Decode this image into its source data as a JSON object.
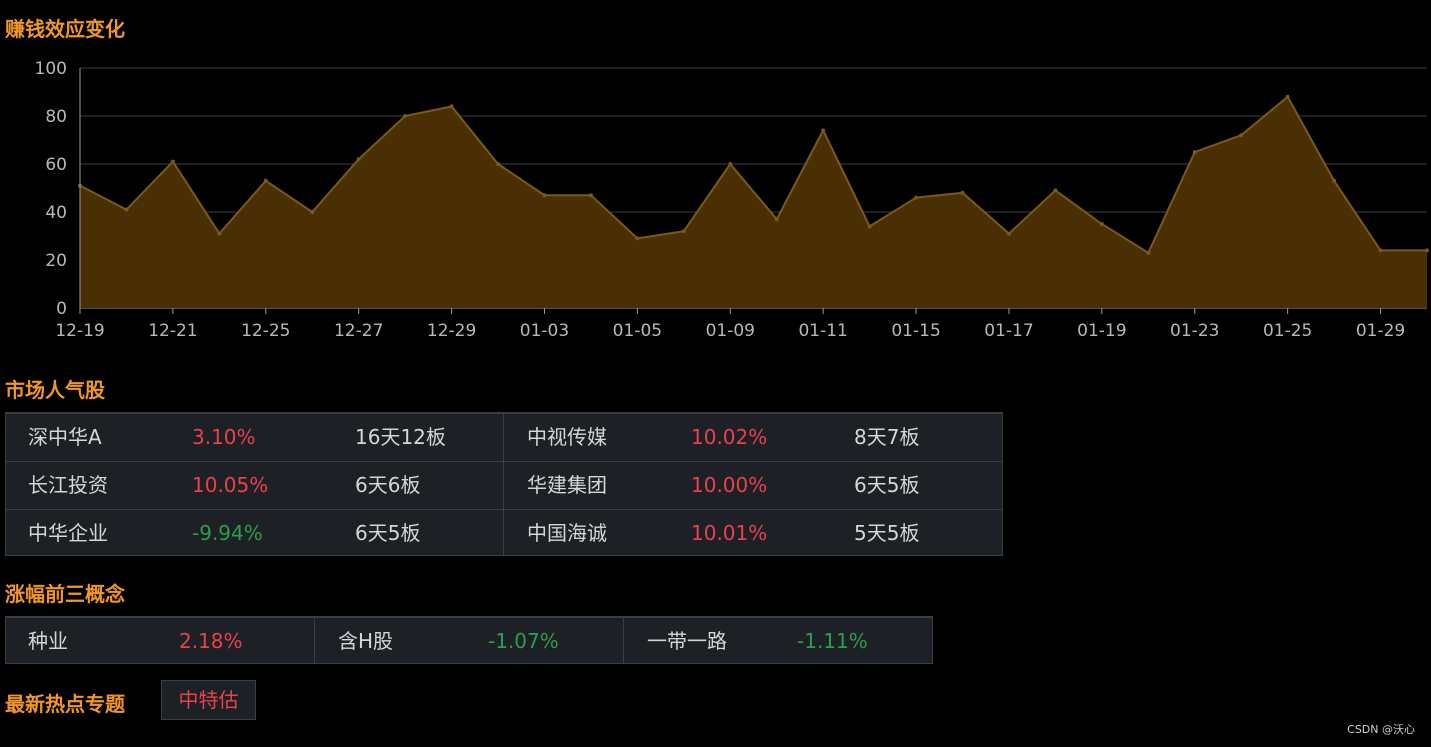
{
  "chart_title": "赚钱效应变化",
  "chart_data": {
    "type": "area",
    "title": "赚钱效应变化",
    "ylim": [
      0,
      100
    ],
    "yticks": [
      0,
      20,
      40,
      60,
      80,
      100
    ],
    "x": [
      "12-19",
      "12-20",
      "12-21",
      "12-22",
      "12-25",
      "12-26",
      "12-27",
      "12-28",
      "12-29",
      "12-30",
      "01-03",
      "01-04",
      "01-05",
      "01-08",
      "01-09",
      "01-10",
      "01-11",
      "01-12",
      "01-15",
      "01-16",
      "01-17",
      "01-18",
      "01-19",
      "01-22",
      "01-23",
      "01-24",
      "01-25",
      "01-26",
      "01-29",
      "01-30"
    ],
    "xtick_labels": [
      "12-19",
      "12-21",
      "12-25",
      "12-27",
      "12-29",
      "01-03",
      "01-05",
      "01-09",
      "01-11",
      "01-15",
      "01-17",
      "01-19",
      "01-23",
      "01-25",
      "01-29"
    ],
    "values": [
      51,
      41,
      61,
      31,
      53,
      40,
      62,
      80,
      84,
      60,
      47,
      47,
      29,
      32,
      60,
      37,
      74,
      34,
      46,
      48,
      31,
      49,
      35,
      23,
      65,
      72,
      88,
      53,
      24,
      24
    ],
    "grid": true,
    "colors": {
      "line": "#7a5a14",
      "fill": "#4a2f05",
      "grid": "#3b3b3b",
      "axis": "#9a9a9a"
    }
  },
  "popular": {
    "title": "市场人气股",
    "rows": [
      [
        {
          "name": "深中华A",
          "pct": "3.10%",
          "dir": "up",
          "board": "16天12板"
        },
        {
          "name": "中视传媒",
          "pct": "10.02%",
          "dir": "up",
          "board": "8天7板"
        }
      ],
      [
        {
          "name": "长江投资",
          "pct": "10.05%",
          "dir": "up",
          "board": "6天6板"
        },
        {
          "name": "华建集团",
          "pct": "10.00%",
          "dir": "up",
          "board": "6天5板"
        }
      ],
      [
        {
          "name": "中华企业",
          "pct": "-9.94%",
          "dir": "down",
          "board": "6天5板"
        },
        {
          "name": "中国海诚",
          "pct": "10.01%",
          "dir": "up",
          "board": "5天5板"
        }
      ]
    ]
  },
  "concepts": {
    "title": "涨幅前三概念",
    "items": [
      {
        "name": "种业",
        "pct": "2.18%",
        "dir": "up"
      },
      {
        "name": "含H股",
        "pct": "-1.07%",
        "dir": "down"
      },
      {
        "name": "一带一路",
        "pct": "-1.11%",
        "dir": "down"
      }
    ]
  },
  "hotspot": {
    "title": "最新热点专题",
    "tag": "中特估"
  },
  "footer": "CSDN @沃心",
  "colors": {
    "accent": "#f0962a",
    "up": "#e8424a",
    "down": "#2c9e4b",
    "panel": "#1d2025"
  }
}
